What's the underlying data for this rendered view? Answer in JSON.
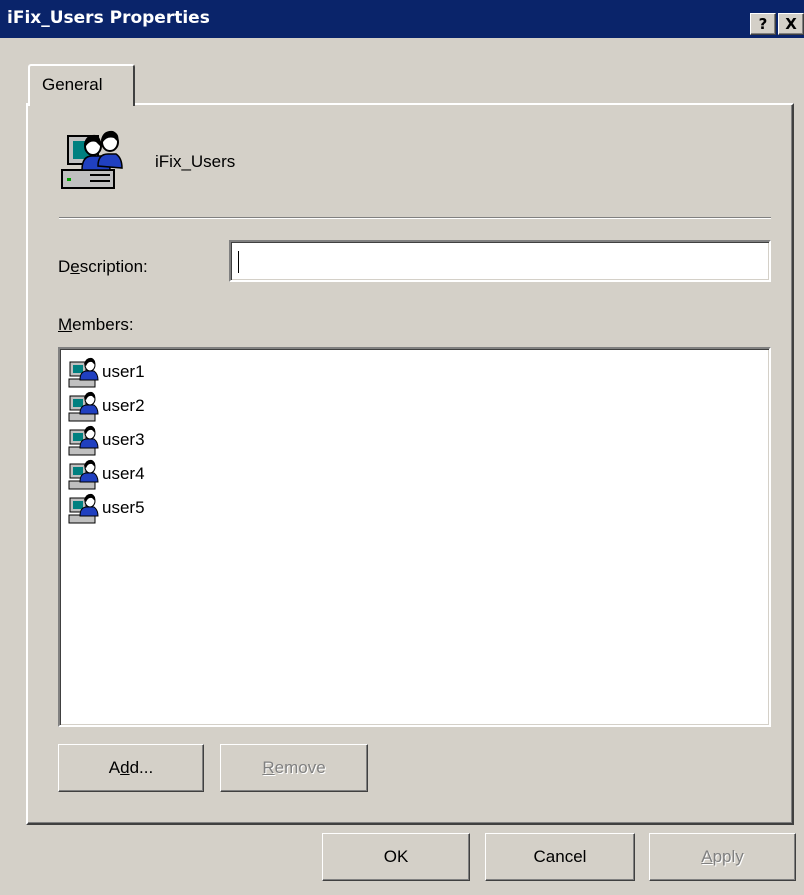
{
  "window": {
    "title": "iFix_Users Properties",
    "help_button": "?",
    "close_button": "X"
  },
  "tabs": [
    {
      "label": "General",
      "selected": true
    }
  ],
  "group": {
    "icon": "user-group-icon",
    "name": "iFix_Users"
  },
  "description": {
    "label_before": "D",
    "label_mnemonic": "e",
    "label_after": "scription:",
    "value": ""
  },
  "members": {
    "label_mnemonic": "M",
    "label_after": "embers:",
    "items": [
      {
        "name": "user1",
        "icon": "user-icon"
      },
      {
        "name": "user2",
        "icon": "user-icon"
      },
      {
        "name": "user3",
        "icon": "user-icon"
      },
      {
        "name": "user4",
        "icon": "user-icon"
      },
      {
        "name": "user5",
        "icon": "user-icon"
      }
    ]
  },
  "buttons": {
    "add": {
      "before": "A",
      "mnemonic": "d",
      "after": "d..."
    },
    "remove": {
      "mnemonic": "R",
      "after": "emove",
      "enabled": false
    },
    "ok": "OK",
    "cancel": "Cancel",
    "apply": {
      "mnemonic": "A",
      "after": "pply",
      "enabled": false
    }
  },
  "colors": {
    "titlebar": "#0a246a",
    "face": "#d4d0c8",
    "disabled_text": "#808080"
  }
}
